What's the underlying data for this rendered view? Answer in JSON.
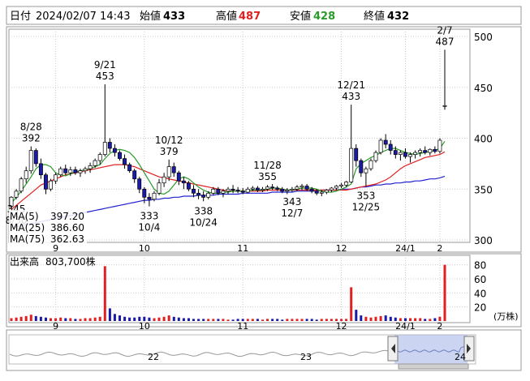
{
  "header": {
    "date_label": "日付",
    "datetime": "2024/02/07 14:43",
    "open_label": "始値",
    "open": "433",
    "high_label": "高値",
    "high": "487",
    "low_label": "安値",
    "low": "428",
    "close_label": "終値",
    "close": "432"
  },
  "legend": {
    "ma5": "MA(5)",
    "ma5_value": "397.20",
    "ma25": "MA(25)",
    "ma25_value": "386.60",
    "ma75": "MA(75)",
    "ma75_value": "362.63"
  },
  "volume": {
    "label": "出来高",
    "value": "803,700株",
    "unit": "(万株)",
    "ticks": [
      "80",
      "60",
      "40",
      "20"
    ]
  },
  "navigator": {
    "labels": [
      "22",
      "23",
      "24"
    ]
  },
  "colors": {
    "up": "#ffffff",
    "down": "#1a1aa8",
    "ma5": "#2a9a2a",
    "ma25": "#e02020",
    "ma75": "#2020d0",
    "volume_up": "#e02020",
    "volume_down": "#1a1aa8",
    "navigator_fill": "#a8b8e8"
  },
  "chart_data": [
    {
      "type": "candlestick",
      "x_ticks": [
        "9",
        "10",
        "11",
        "12",
        "24/1",
        "2"
      ],
      "y_ticks": [
        500,
        450,
        400,
        350,
        300
      ],
      "ylim": [
        300,
        500
      ],
      "annotations": [
        {
          "date": "8/28",
          "value": "392"
        },
        {
          "date": "9/21",
          "value": "453"
        },
        {
          "date": "10/12",
          "value": "379"
        },
        {
          "date": "11/28",
          "value": "355"
        },
        {
          "date": "12/21",
          "value": "433"
        },
        {
          "date": "2/7",
          "value": "487"
        },
        {
          "date": "8/30",
          "value": "345"
        },
        {
          "date": "10/4",
          "value": "333"
        },
        {
          "date": "10/24",
          "value": "338"
        },
        {
          "date": "12/7",
          "value": "343"
        },
        {
          "date": "12/25",
          "value": "353"
        }
      ],
      "candles": [
        [
          333,
          343,
          331,
          342
        ],
        [
          342,
          350,
          340,
          348
        ],
        [
          348,
          362,
          346,
          360
        ],
        [
          360,
          372,
          356,
          368
        ],
        [
          368,
          392,
          365,
          388
        ],
        [
          388,
          390,
          372,
          375
        ],
        [
          375,
          380,
          360,
          364
        ],
        [
          364,
          366,
          345,
          350
        ],
        [
          350,
          360,
          348,
          358
        ],
        [
          358,
          366,
          355,
          364
        ],
        [
          364,
          372,
          362,
          370
        ],
        [
          370,
          374,
          364,
          366
        ],
        [
          366,
          372,
          363,
          369
        ],
        [
          369,
          372,
          364,
          366
        ],
        [
          366,
          370,
          362,
          368
        ],
        [
          368,
          372,
          365,
          370
        ],
        [
          370,
          376,
          366,
          373
        ],
        [
          373,
          380,
          371,
          378
        ],
        [
          378,
          386,
          374,
          384
        ],
        [
          384,
          453,
          382,
          396
        ],
        [
          396,
          400,
          386,
          390
        ],
        [
          390,
          394,
          382,
          386
        ],
        [
          386,
          388,
          378,
          380
        ],
        [
          380,
          384,
          370,
          374
        ],
        [
          374,
          376,
          366,
          368
        ],
        [
          368,
          370,
          356,
          360
        ],
        [
          360,
          362,
          346,
          350
        ],
        [
          350,
          352,
          336,
          342
        ],
        [
          342,
          346,
          333,
          340
        ],
        [
          340,
          348,
          338,
          346
        ],
        [
          346,
          360,
          344,
          356
        ],
        [
          356,
          366,
          352,
          362
        ],
        [
          362,
          379,
          358,
          372
        ],
        [
          372,
          376,
          362,
          366
        ],
        [
          366,
          368,
          354,
          358
        ],
        [
          358,
          362,
          350,
          356
        ],
        [
          356,
          358,
          348,
          350
        ],
        [
          350,
          354,
          342,
          346
        ],
        [
          346,
          350,
          340,
          344
        ],
        [
          344,
          348,
          338,
          342
        ],
        [
          342,
          348,
          340,
          346
        ],
        [
          346,
          352,
          344,
          350
        ],
        [
          350,
          352,
          344,
          346
        ],
        [
          346,
          350,
          342,
          348
        ],
        [
          348,
          352,
          345,
          350
        ],
        [
          350,
          354,
          346,
          349
        ],
        [
          349,
          352,
          346,
          348
        ],
        [
          348,
          351,
          345,
          347
        ],
        [
          347,
          352,
          346,
          350
        ],
        [
          350,
          353,
          348,
          351
        ],
        [
          351,
          353,
          347,
          349
        ],
        [
          349,
          352,
          347,
          350
        ],
        [
          350,
          354,
          348,
          352
        ],
        [
          352,
          355,
          349,
          351
        ],
        [
          351,
          353,
          348,
          350
        ],
        [
          350,
          352,
          346,
          348
        ],
        [
          348,
          351,
          345,
          349
        ],
        [
          349,
          352,
          347,
          350
        ],
        [
          350,
          354,
          348,
          352
        ],
        [
          352,
          355,
          349,
          353
        ],
        [
          353,
          355,
          348,
          350
        ],
        [
          350,
          352,
          346,
          348
        ],
        [
          348,
          350,
          344,
          346
        ],
        [
          346,
          349,
          343,
          347
        ],
        [
          347,
          350,
          345,
          349
        ],
        [
          349,
          352,
          347,
          351
        ],
        [
          351,
          354,
          349,
          353
        ],
        [
          353,
          356,
          351,
          354
        ],
        [
          354,
          358,
          352,
          357
        ],
        [
          357,
          433,
          356,
          390
        ],
        [
          390,
          394,
          372,
          378
        ],
        [
          378,
          380,
          362,
          366
        ],
        [
          366,
          372,
          353,
          370
        ],
        [
          370,
          380,
          368,
          378
        ],
        [
          378,
          388,
          376,
          386
        ],
        [
          386,
          400,
          384,
          398
        ],
        [
          398,
          404,
          390,
          394
        ],
        [
          394,
          398,
          384,
          388
        ],
        [
          388,
          392,
          380,
          384
        ],
        [
          384,
          388,
          378,
          386
        ],
        [
          386,
          390,
          380,
          382
        ],
        [
          382,
          386,
          376,
          384
        ],
        [
          384,
          388,
          380,
          386
        ],
        [
          386,
          390,
          382,
          388
        ],
        [
          388,
          392,
          384,
          386
        ],
        [
          386,
          390,
          383,
          389
        ],
        [
          389,
          392,
          385,
          387
        ],
        [
          387,
          400,
          385,
          398
        ],
        [
          432,
          487,
          428,
          432
        ]
      ],
      "ma5": [
        336,
        342,
        348,
        355,
        362,
        370,
        374,
        374,
        372,
        366,
        364,
        363,
        365,
        367,
        368,
        369,
        370,
        372,
        374,
        380,
        385,
        388,
        389,
        388,
        386,
        381,
        374,
        366,
        358,
        350,
        346,
        345,
        348,
        354,
        360,
        362,
        360,
        356,
        352,
        349,
        347,
        346,
        346,
        347,
        347,
        348,
        348,
        348,
        348,
        349,
        349,
        349,
        350,
        351,
        351,
        350,
        349,
        349,
        350,
        351,
        351,
        351,
        350,
        348,
        347,
        347,
        348,
        350,
        352,
        355,
        370,
        375,
        378,
        381,
        383,
        386,
        388,
        390,
        390,
        388,
        386,
        385,
        384,
        385,
        386,
        387,
        388,
        390,
        397
      ],
      "ma25": [
        330,
        334,
        338,
        342,
        346,
        350,
        354,
        356,
        358,
        360,
        362,
        364,
        365,
        366,
        367,
        368,
        369,
        370,
        371,
        372,
        373,
        374,
        374,
        374,
        373,
        372,
        370,
        368,
        366,
        364,
        362,
        361,
        360,
        359,
        358,
        357,
        356,
        355,
        354,
        353,
        352,
        351,
        350,
        349,
        348,
        348,
        348,
        348,
        348,
        348,
        348,
        348,
        349,
        349,
        349,
        349,
        349,
        349,
        349,
        349,
        349,
        349,
        349,
        349,
        349,
        349,
        349,
        349,
        349,
        350,
        351,
        352,
        353,
        354,
        355,
        357,
        359,
        362,
        366,
        370,
        373,
        375,
        377,
        379,
        381,
        382,
        383,
        384,
        386.6
      ],
      "ma75": [
        312,
        313,
        314,
        315,
        316,
        317,
        318,
        319,
        320,
        321,
        322,
        323,
        324,
        325,
        326,
        327,
        328,
        329,
        330,
        331,
        332,
        333,
        334,
        335,
        336,
        337,
        338,
        339,
        339,
        340,
        340,
        341,
        341,
        342,
        342,
        343,
        343,
        343,
        344,
        344,
        344,
        344,
        345,
        345,
        345,
        345,
        345,
        346,
        346,
        346,
        346,
        346,
        346,
        347,
        347,
        347,
        347,
        347,
        348,
        348,
        348,
        348,
        348,
        349,
        349,
        349,
        349,
        350,
        350,
        350,
        351,
        352,
        352,
        353,
        354,
        354,
        355,
        355,
        356,
        356,
        357,
        357,
        358,
        358,
        359,
        360,
        360,
        361,
        362.63
      ]
    },
    {
      "type": "bar",
      "title": "出来高",
      "y_ticks": [
        80,
        60,
        40,
        20
      ],
      "ylim": [
        0,
        90
      ],
      "values": [
        4,
        5,
        6,
        7,
        9,
        7,
        6,
        5,
        4,
        4,
        5,
        4,
        4,
        3,
        3,
        4,
        4,
        5,
        6,
        78,
        18,
        10,
        8,
        6,
        5,
        5,
        6,
        6,
        5,
        4,
        5,
        6,
        8,
        6,
        5,
        4,
        4,
        3,
        3,
        3,
        3,
        3,
        3,
        3,
        2,
        2,
        3,
        3,
        3,
        3,
        3,
        2,
        3,
        3,
        3,
        2,
        3,
        3,
        3,
        3,
        3,
        3,
        2,
        3,
        3,
        3,
        3,
        3,
        3,
        48,
        16,
        8,
        6,
        5,
        6,
        7,
        8,
        6,
        5,
        4,
        4,
        4,
        4,
        4,
        3,
        3,
        4,
        6,
        80
      ]
    }
  ]
}
